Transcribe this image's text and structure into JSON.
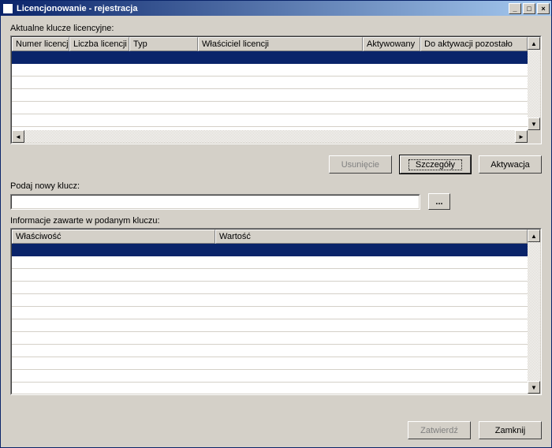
{
  "window": {
    "title": "Licencjonowanie - rejestracja"
  },
  "labels": {
    "current_keys": "Aktualne klucze licencyjne:",
    "new_key": "Podaj nowy klucz:",
    "key_info": "Informacje zawarte w podanym kluczu:"
  },
  "grid1": {
    "columns": {
      "col0": "Numer licencji",
      "col1": "Liczba licencji",
      "col2": "Typ",
      "col3": "Właściciel licencji",
      "col4": "Aktywowany",
      "col5": "Do aktywacji pozostało"
    }
  },
  "grid2": {
    "columns": {
      "col0": "Właściwość",
      "col1": "Wartość"
    }
  },
  "buttons": {
    "delete": "Usunięcie",
    "details": "Szczegóły",
    "activate": "Aktywacja",
    "confirm": "Zatwierdź",
    "close": "Zamknij",
    "browse": "..."
  },
  "input": {
    "new_key_value": ""
  }
}
